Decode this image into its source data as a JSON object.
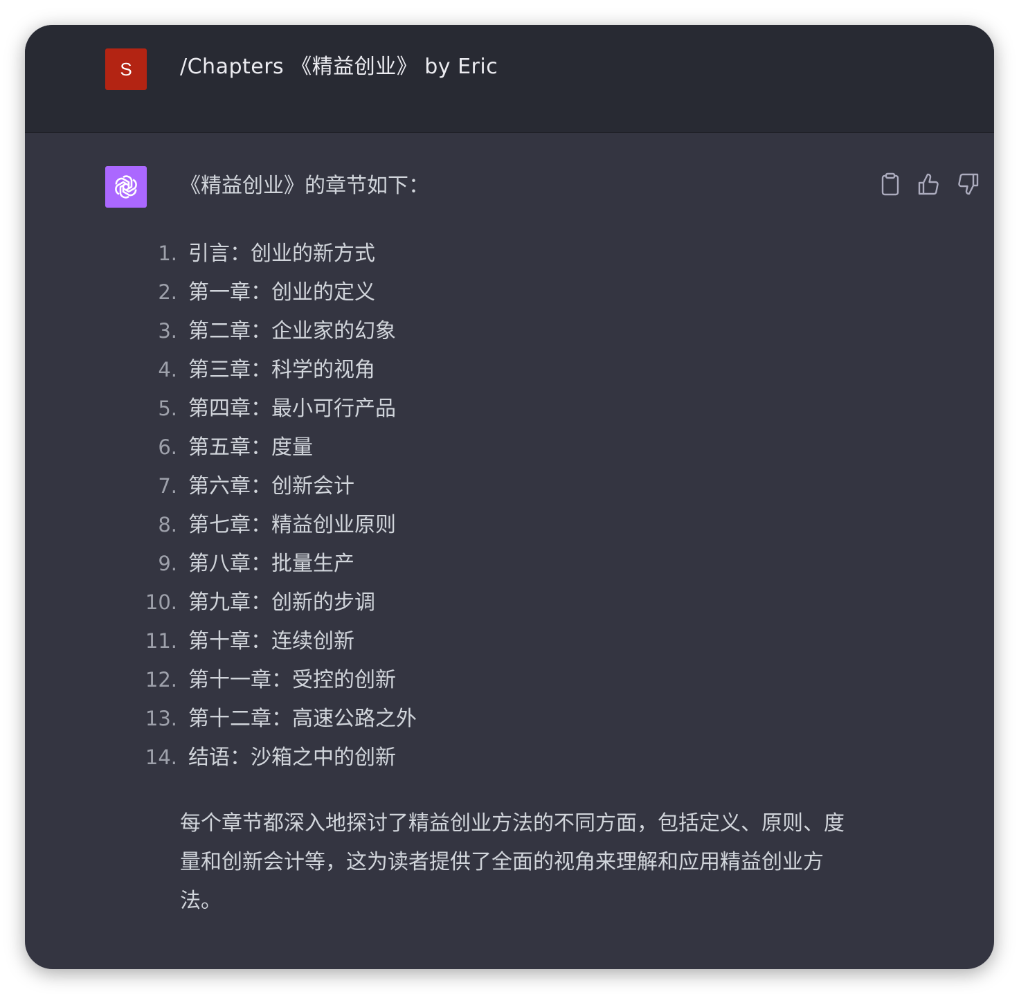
{
  "user": {
    "avatar_letter": "S",
    "message": "/Chapters 《精益创业》 by Eric"
  },
  "assistant": {
    "avatar_icon": "openai-logo-icon",
    "intro": "《精益创业》的章节如下：",
    "chapters": [
      {
        "num": "1.",
        "text": "引言：创业的新方式"
      },
      {
        "num": "2.",
        "text": "第一章：创业的定义"
      },
      {
        "num": "3.",
        "text": "第二章：企业家的幻象"
      },
      {
        "num": "4.",
        "text": "第三章：科学的视角"
      },
      {
        "num": "5.",
        "text": "第四章：最小可行产品"
      },
      {
        "num": "6.",
        "text": "第五章：度量"
      },
      {
        "num": "7.",
        "text": "第六章：创新会计"
      },
      {
        "num": "8.",
        "text": "第七章：精益创业原则"
      },
      {
        "num": "9.",
        "text": "第八章：批量生产"
      },
      {
        "num": "10.",
        "text": "第九章：创新的步调"
      },
      {
        "num": "11.",
        "text": "第十章：连续创新"
      },
      {
        "num": "12.",
        "text": "第十一章：受控的创新"
      },
      {
        "num": "13.",
        "text": "第十二章：高速公路之外"
      },
      {
        "num": "14.",
        "text": "结语：沙箱之中的创新"
      }
    ],
    "summary": "每个章节都深入地探讨了精益创业方法的不同方面，包括定义、原则、度量和创新会计等，这为读者提供了全面的视角来理解和应用精益创业方法。"
  },
  "actions": {
    "icons": [
      "clipboard-icon",
      "thumbs-up-icon",
      "thumbs-down-icon"
    ]
  },
  "colors": {
    "user_row_bg": "#282a33",
    "assistant_row_bg": "#343541",
    "user_avatar_bg": "#b32413",
    "bot_avatar_bg": "#ab68ff",
    "text": "#d1d5db",
    "icon": "#acacbe"
  }
}
